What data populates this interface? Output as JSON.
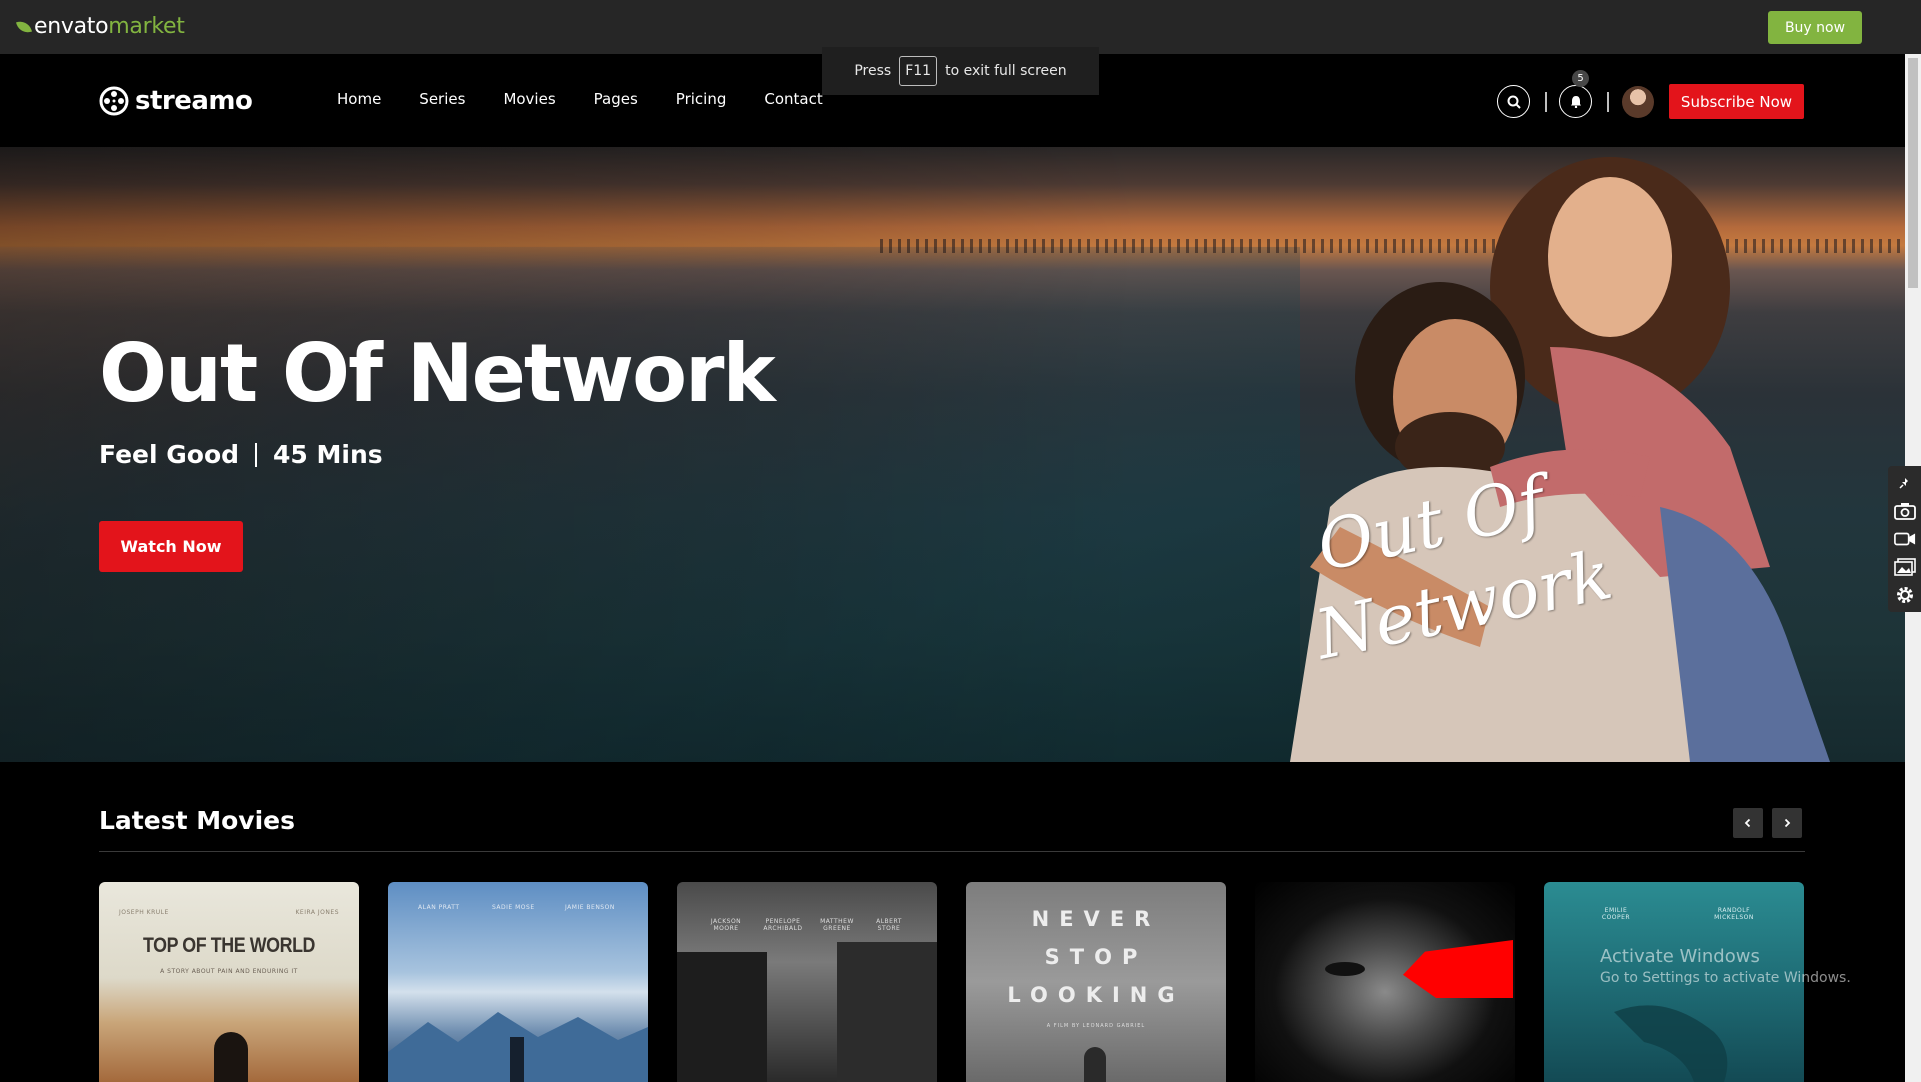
{
  "envato_bar": {
    "logo_word": "envato",
    "logo_market": "market",
    "buy_now": "Buy now",
    "accent": "#82b440"
  },
  "fullscreen_toast": {
    "press": "Press",
    "key": "F11",
    "rest": "to exit full screen"
  },
  "nav": {
    "brand": "streamo",
    "links": [
      "Home",
      "Series",
      "Movies",
      "Pages",
      "Pricing",
      "Contact"
    ],
    "notification_count": "5",
    "subscribe_label": "Subscribe Now",
    "accent": "#e3141b",
    "icons": [
      "search-icon",
      "bell-icon",
      "avatar"
    ]
  },
  "hero": {
    "title": "Out Of Network",
    "genre": "Feel Good",
    "duration": "45 Mins",
    "watch_label": "Watch Now",
    "script_line1": "Out Of",
    "script_line2": "Network"
  },
  "latest": {
    "heading": "Latest Movies",
    "prev_icon": "chevron-left-icon",
    "next_icon": "chevron-right-icon",
    "cards": [
      {
        "title": "TOP OF THE WORLD",
        "subtitle": "A STORY ABOUT PAIN AND ENDURING IT",
        "credit_left": "JOSEPH KRULE",
        "credit_right": "KEIRA JONES"
      },
      {
        "credits": [
          "ALAN PRATT",
          "SADIE MOSE",
          "JAMIE BENSON"
        ]
      },
      {
        "credits": [
          "JACKSON MOORE",
          "PENELOPE ARCHIBALD",
          "MATTHEW GREENE",
          "ALBERT STORE"
        ]
      },
      {
        "line1": "NEVER",
        "line2": "STOP",
        "line3": "LOOKING",
        "credit": "A FILM BY LEONARD GABRIEL"
      },
      {},
      {
        "credit_left": "EMILIE COOPER",
        "credit_right": "RANDOLF MICKELSON"
      }
    ]
  },
  "windows_watermark": {
    "line1": "Activate Windows",
    "line2": "Go to Settings to activate Windows."
  },
  "side_tools": [
    "pin-icon",
    "camera-icon",
    "video-icon",
    "gallery-icon",
    "gear-icon"
  ]
}
